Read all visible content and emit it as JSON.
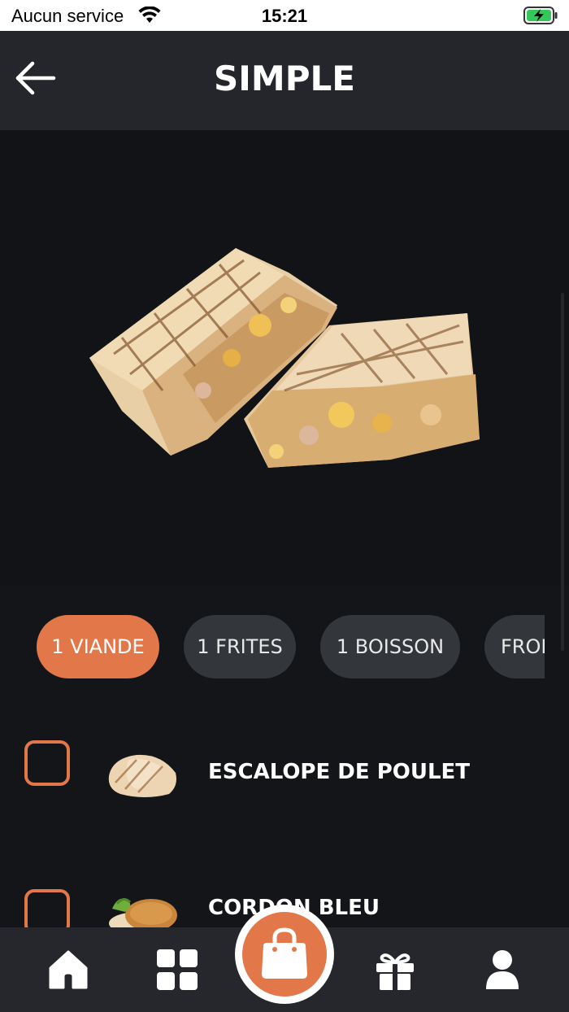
{
  "status_bar": {
    "carrier": "Aucun service",
    "time": "15:21",
    "wifi_icon": "wifi-icon",
    "battery_icon": "battery-charging-icon"
  },
  "header": {
    "title": "SIMPLE",
    "back_icon": "arrow-left-icon"
  },
  "hero": {
    "image": "wrap-sandwich-image"
  },
  "chips": [
    {
      "label": "1 VIANDE",
      "active": true
    },
    {
      "label": "1 FRITES",
      "active": false
    },
    {
      "label": "1 BOISSON",
      "active": false
    },
    {
      "label": "FROMAGE",
      "active": false
    }
  ],
  "options": [
    {
      "label": "ESCALOPE DE POULET",
      "checked": false,
      "thumb": "grilled-chicken-image"
    },
    {
      "label": "CORDON BLEU",
      "checked": false,
      "thumb": "cordon-bleu-image"
    }
  ],
  "bottom_nav": {
    "items": [
      "home-icon",
      "grid-icon",
      "shopping-bag-icon",
      "gift-icon",
      "user-icon"
    ]
  },
  "colors": {
    "accent": "#e2784a",
    "background": "#141518",
    "header": "#24262b",
    "chip": "#33363b"
  }
}
